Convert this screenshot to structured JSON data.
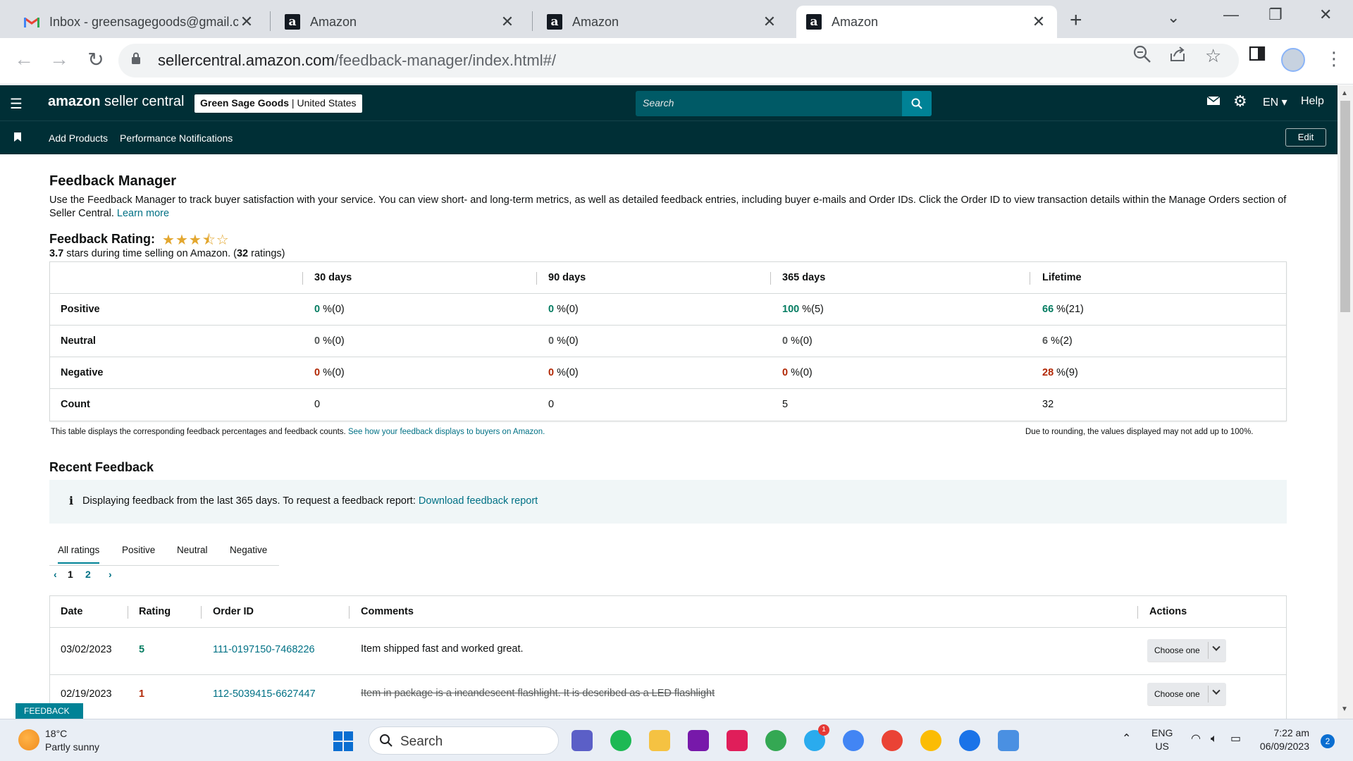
{
  "browser": {
    "tabs": [
      {
        "title": "Inbox - greensagegoods@gmail.com",
        "favicon": "gmail-icon"
      },
      {
        "title": "Amazon",
        "favicon": "amazon-icon"
      },
      {
        "title": "Amazon",
        "favicon": "amazon-icon"
      },
      {
        "title": "Amazon",
        "favicon": "amazon-icon",
        "active": true
      }
    ],
    "url_host": "sellercentral.amazon.com",
    "url_path": "/feedback-manager/index.html#/"
  },
  "header": {
    "logo_bold": "amazon",
    "logo_rest": " seller central",
    "store_name": "Green Sage Goods",
    "store_region": " | United States",
    "search_placeholder": "Search",
    "language": "EN",
    "help": "Help",
    "subnav": [
      "Add Products",
      "Performance Notifications"
    ],
    "edit": "Edit"
  },
  "page": {
    "title": "Feedback Manager",
    "description": "Use the Feedback Manager to track buyer satisfaction with your service. You can view short- and long-term metrics, as well as detailed feedback entries, including buyer e-mails and Order IDs. Click the Order ID to view transaction details within the Manage Orders section of Seller Central. ",
    "learn_more": "Learn more",
    "rating_title": "Feedback Rating:",
    "stars_value": 3.7,
    "rating_stars": "3.7",
    "rating_mid": " stars during time selling on Amazon. (",
    "rating_count": "32",
    "rating_end": " ratings)"
  },
  "summary_table": {
    "columns": [
      "30 days",
      "90 days",
      "365 days",
      "Lifetime"
    ],
    "rows": [
      {
        "label": "Positive",
        "values": [
          "0",
          "0",
          "100",
          "66"
        ],
        "counts": [
          " %(0)",
          " %(0)",
          " %(5)",
          " %(21)"
        ]
      },
      {
        "label": "Neutral",
        "values": [
          "0",
          "0",
          "0",
          "6"
        ],
        "counts": [
          " %(0)",
          " %(0)",
          " %(0)",
          " %(2)"
        ]
      },
      {
        "label": "Negative",
        "values": [
          "0",
          "0",
          "0",
          "28"
        ],
        "counts": [
          " %(0)",
          " %(0)",
          " %(0)",
          " %(9)"
        ]
      },
      {
        "label": "Count",
        "values": [
          "0",
          "0",
          "5",
          "32"
        ]
      }
    ],
    "note_left": "This table displays the corresponding feedback percentages and feedback counts. ",
    "note_link": "See how your feedback displays to buyers on Amazon.",
    "note_right": "Due to rounding, the values displayed may not add up to 100%."
  },
  "recent": {
    "title": "Recent Feedback",
    "info_text": "Displaying feedback from the last 365 days. To request a feedback report: ",
    "info_link": "Download feedback report",
    "tabs": [
      "All ratings",
      "Positive",
      "Neutral",
      "Negative"
    ],
    "pages": [
      "1",
      "2"
    ],
    "columns": [
      "Date",
      "Rating",
      "Order ID",
      "Comments",
      "Actions"
    ],
    "rows": [
      {
        "date": "03/02/2023",
        "rating": "5",
        "order_id": "111-0197150-7468226",
        "comment": "Item shipped fast and worked great.",
        "action": "Choose one"
      },
      {
        "date": "02/19/2023",
        "rating": "1",
        "order_id": "112-5039415-6627447",
        "comment": "Item in package is a incandescent flashlight. It is described as a LED flashlight",
        "action": "Choose one"
      }
    ]
  },
  "feedback_tab": "FEEDBACK ×",
  "taskbar": {
    "weather_temp": "18°C",
    "weather_desc": "Partly sunny",
    "search": "Search",
    "lang1": "ENG",
    "lang2": "US",
    "time": "7:22 am",
    "date": "06/09/2023",
    "notifications": "2",
    "telegram_badge": "1"
  }
}
